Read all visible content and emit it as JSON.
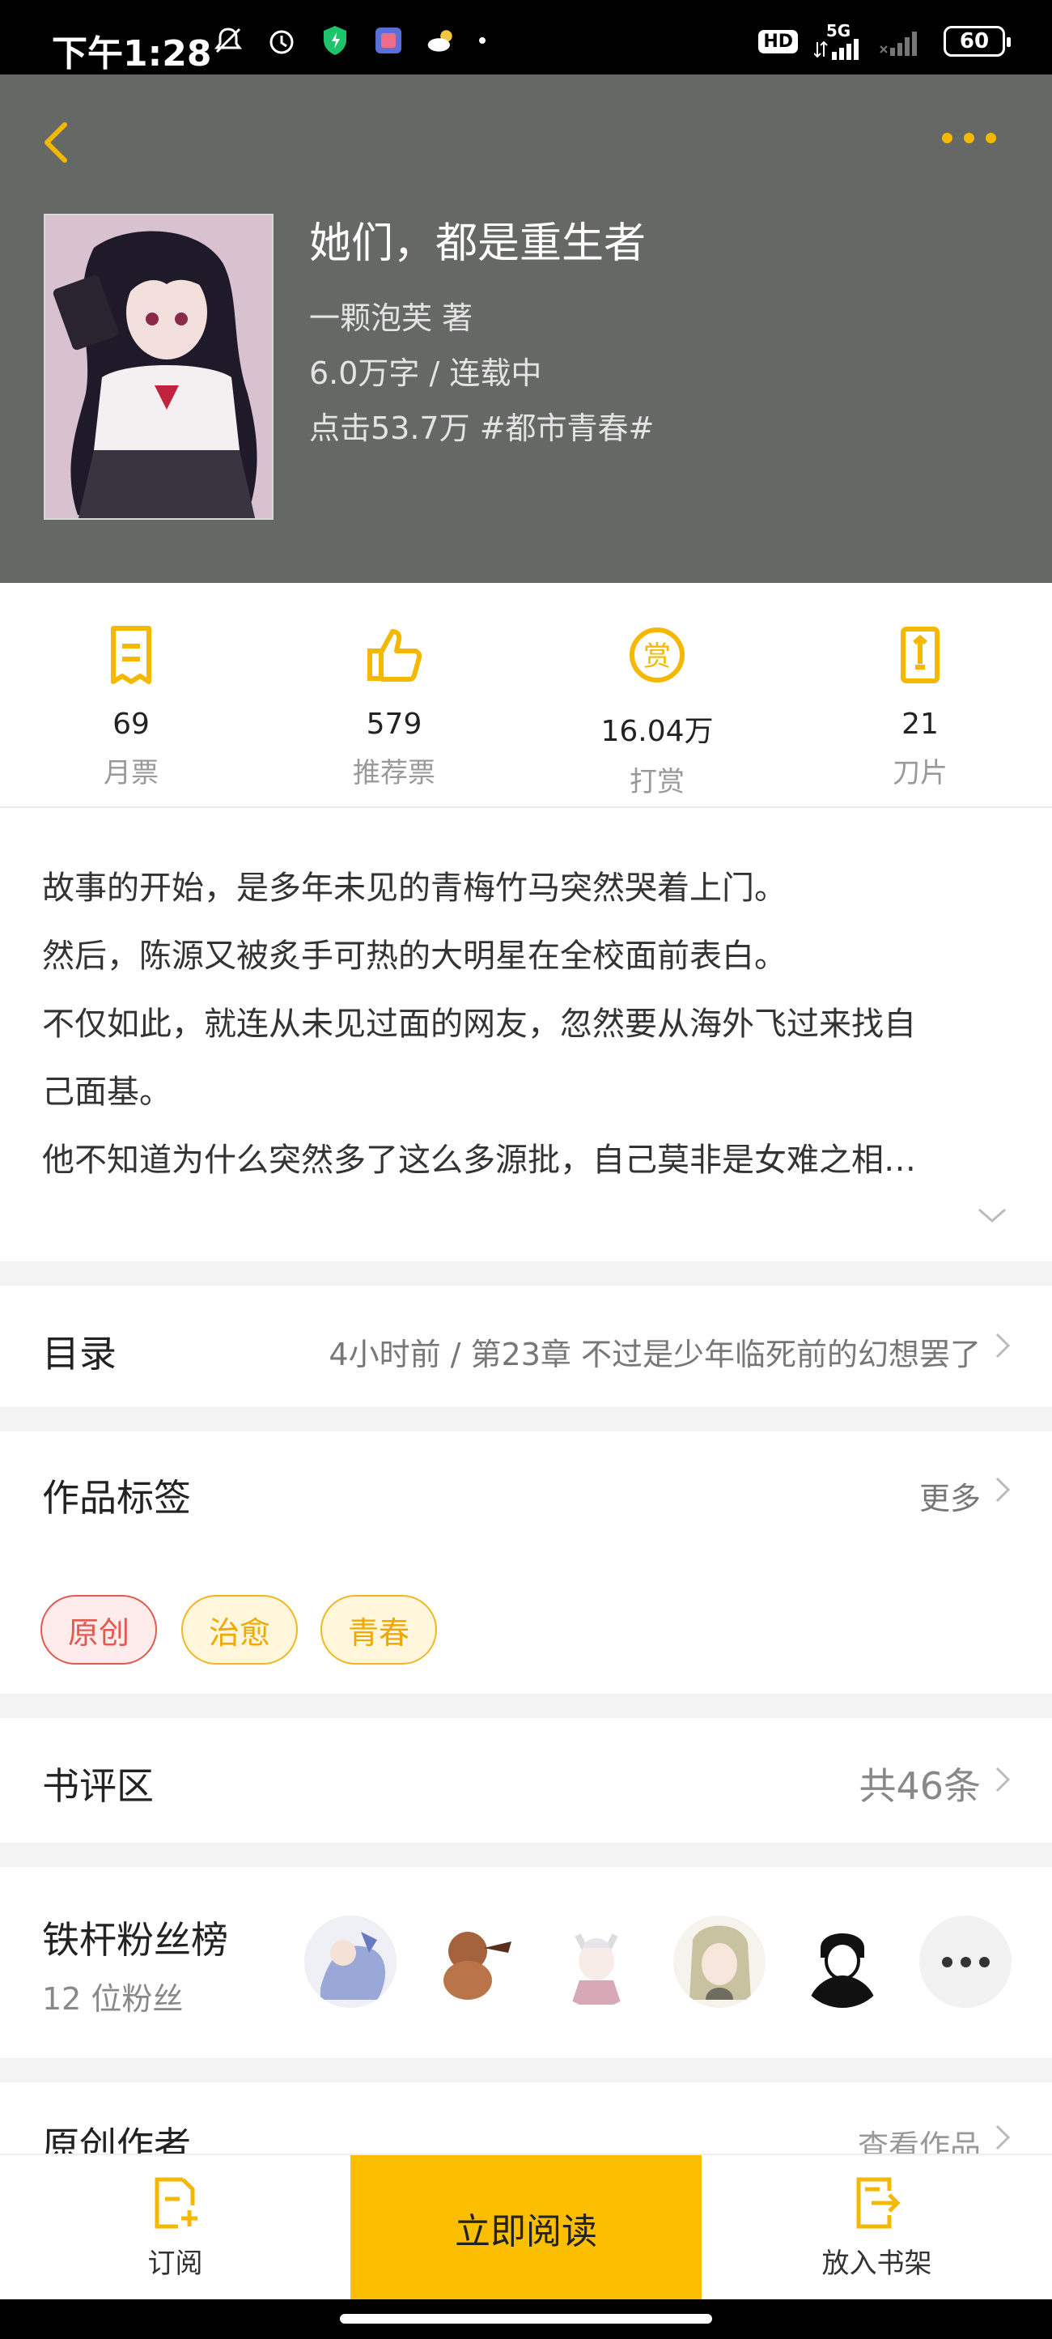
{
  "status_bar": {
    "time": "下午1:28",
    "hd": "HD",
    "network": "5G",
    "battery": "60"
  },
  "book": {
    "title": "她们，都是重生者",
    "author_line": "一颗泡芙  著",
    "wordcount_status": "6.0万字 / 连载中",
    "clicks_genre": "点击53.7万  #都市青春#"
  },
  "stats": [
    {
      "icon": "monthly-ticket-icon",
      "value": "69",
      "label": "月票"
    },
    {
      "icon": "thumbs-up-icon",
      "value": "579",
      "label": "推荐票"
    },
    {
      "icon": "reward-coin-icon",
      "value": "16.04万",
      "label": "打赏"
    },
    {
      "icon": "blade-card-icon",
      "value": "21",
      "label": "刀片"
    }
  ],
  "description": [
    "故事的开始，是多年未见的青梅竹马突然哭着上门。",
    "然后，陈源又被炙手可热的大明星在全校面前表白。",
    "不仅如此，就连从未见过面的网友，忽然要从海外飞过来找自",
    "己面基。",
    "他不知道为什么突然多了这么多源批，自己莫非是女难之相…"
  ],
  "catalog": {
    "title": "目录",
    "latest": "4小时前 / 第23章 不过是少年临死前的幻想罢了"
  },
  "tags_section": {
    "title": "作品标签",
    "more": "更多",
    "tags": [
      {
        "label": "原创",
        "color": "#e05a4f",
        "bg": "#fdeceb"
      },
      {
        "label": "治愈",
        "color": "#f0a800",
        "bg": "#fff6dc"
      },
      {
        "label": "青春",
        "color": "#f0a800",
        "bg": "#fff6dc"
      }
    ]
  },
  "reviews": {
    "title": "书评区",
    "count": "共46条"
  },
  "fans": {
    "title": "铁杆粉丝榜",
    "count": "12 位粉丝"
  },
  "author_section": {
    "title": "原创作者",
    "link": "查看作品"
  },
  "bottom_bar": {
    "subscribe": "订阅",
    "read_now": "立即阅读",
    "add_shelf": "放入书架"
  },
  "colors": {
    "accent": "#fcbe00",
    "icon_accent": "#f5b800",
    "header_bg": "#666866"
  }
}
